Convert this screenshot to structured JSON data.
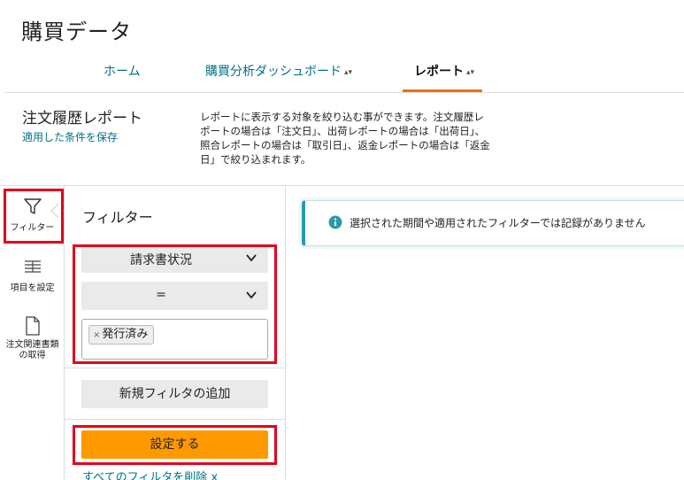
{
  "app": {
    "title": "購買データ"
  },
  "nav": {
    "tabs": [
      {
        "label": "ホーム"
      },
      {
        "label": "購買分析ダッシュボード"
      },
      {
        "label": "レポート"
      }
    ]
  },
  "report": {
    "title": "注文履歴レポート",
    "save_label": "適用した条件を保存",
    "description": "レポートに表示する対象を絞り込む事ができます。注文履歴レポートの場合は「注文日」、出荷レポートの場合は「出荷日」、照合レポートの場合は「取引日」、返金レポートの場合は「返金日」で絞り込まれます。"
  },
  "rail": {
    "filter_label": "フィルター",
    "columns_label": "項目を設定",
    "docs_label": "注文関連書類の取得"
  },
  "filter": {
    "title": "フィルター",
    "field_select": "請求書状況",
    "operator_select": "=",
    "chip_label": "発行済み",
    "chip_remove": "×",
    "add_label": "新規フィルタの追加",
    "apply_label": "設定する",
    "clear_label": "すべてのフィルタを削除 x"
  },
  "alert": {
    "message": "選択された期間や適用されたフィルターでは記録がありません"
  },
  "colors": {
    "link": "#007185",
    "accent": "#e77600",
    "button": "#ff9900",
    "highlight": "#e3001b",
    "info": "#2a9aa8"
  },
  "icons": [
    "filter-icon",
    "columns-icon",
    "document-icon",
    "chevron-down-icon",
    "info-icon",
    "caret-sort-icon"
  ]
}
